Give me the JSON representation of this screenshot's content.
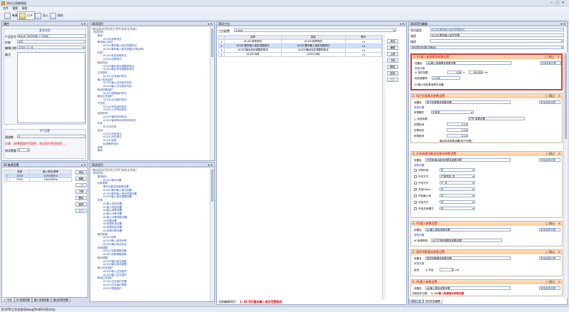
{
  "app": {
    "title": "测试方案编辑器",
    "min": "─",
    "max": "□",
    "close": "✕"
  },
  "menu": [
    "文件",
    "视图",
    "帮助"
  ],
  "toolbar": [
    "新建",
    "打开",
    "导入",
    "保存"
  ],
  "props": {
    "header": "属性",
    "product_group": "基本信息",
    "fields": [
      {
        "label": "产品型号",
        "value": "BxJu5_2005046_(-750N)"
      },
      {
        "label": "作者",
        "value": "ATE"
      },
      {
        "label": "编辑日期",
        "value": "2025 / 3 / 6"
      },
      {
        "label": "备注",
        "value": ""
      }
    ],
    "ivt_group": "IVT设置",
    "ivt_fields": [
      {
        "label": "通道数",
        "value": "0"
      },
      {
        "label": "测试数量",
        "value": "0"
      }
    ],
    "ivt_note": "注意：选择通道时先暂停，测试项目将添加到……"
  },
  "power": {
    "header": "AC电源设置",
    "cols": [
      "",
      "名称",
      "输入电压/频率"
    ],
    "rows": [
      {
        "idx": "1",
        "name": "120V",
        "val": "120V/60Hz"
      },
      {
        "idx": "2",
        "name": "230V",
        "val": "230V/50Hz"
      }
    ],
    "buttons": [
      "添加",
      "编辑",
      "上移",
      "下移",
      "删除",
      "复制",
      "粘贴"
    ]
  },
  "bottom_tabs": [
    "AC电源",
    "DC电源设置",
    "输入电源设置",
    "输出负载设置"
  ],
  "lib_tree": {
    "header": "测试项目",
    "subheader": "(拖动测试项目到工序栏或双击添加)",
    "items": [
      "测试项目",
      "静态",
      "AC/DC效率测试",
      "基本输入测试",
      "AC/DC基本输入电压范围测试",
      "AC/DC基本输入电压范围(计算功率)",
      "负载",
      "AC/DC动态负载测试",
      "AC/DC负载测试",
      "输出特性",
      "AC/DC输出电压调整率测试",
      "AC/DC输出电流调整率测试",
      "过流保护",
      "AC/DC过流保护测试",
      "输入电压保护",
      "AC/DC输入过压保护测试",
      "AC/DC输入欠压保护测试",
      "输出短路保护",
      "AC/DC短路保护测试",
      "输出过压保护",
      "AC/DC过压保护测试",
      "开关机",
      "AC/DC开机延时测试",
      "AC/DC上升时间测试",
      "保持时间",
      "AC/DC保持时间测试",
      "AC/DC保持时间(依时间测试)",
      "时序",
      "AC/DC时序",
      "启动",
      "AC/DC开机测试",
      "AC/DC关机测试",
      "AC/DC浪涌",
      "纹波噪声测试",
      "效率",
      "静态"
    ]
  },
  "cfg_tree": {
    "header": "测试项目",
    "subheader": "(拖动测试项目到工序栏或双击添加)",
    "items": [
      "测试项目",
      "基本输入",
      "AC/DC基本设置",
      "控制参数",
      "基本功能控制参数设置",
      "AC/DC基本输入电压设置",
      "AC/DC基本输入电压范围设置",
      "AC/DC输入电压调整设置",
      "其他",
      "AC输入电压设置",
      "AC输入电流设置",
      "AC输入频率设置",
      "AC输入功率设置",
      "AC输入功率因数设置",
      "AC负载设置",
      "AC负载电流设置",
      "AC负载电压设置",
      "AC负载功率设置",
      "静态参数",
      "AC/DC效率",
      "AC/DC输入电流效率",
      "AC/DC输出电压电流",
      "负载调整",
      "AC/DC负载调整设置",
      "AC/DC负载调整参数",
      "输出调整",
      "AC/DC输出电压调整",
      "AC/DC输出电流调整",
      "输入电压保护",
      "AC/DC输入过压保护",
      "AC/DC输入欠压保护",
      "输出过压保护",
      "AC/DC过压保护设置",
      "AC/DC过压保护参数",
      "AC/DC短路保护"
    ]
  },
  "seq": {
    "header": "测试工位",
    "label": "工位配置",
    "value": "1.test",
    "cols": [
      "",
      "名称",
      "描述",
      "条件"
    ],
    "rows": [
      {
        "i": "1",
        "name": "AC/DC效率测试",
        "desc": "AC/DC效率测试",
        "c": "<1"
      },
      {
        "i": "2",
        "name": "AC/DC基本输入电压范围测试",
        "desc": "AC/DC基本输入电压范围测试",
        "c": "<1"
      },
      {
        "i": "3",
        "name": "AC/DC输出电压调整率测试",
        "desc": "AC/DC输出电压调整率测试",
        "c": "<1"
      },
      {
        "i": "4",
        "name": "AC/DC功耗",
        "desc": "AC/DC功耗",
        "c": "<1"
      }
    ],
    "buttons": [
      "添加",
      "编辑",
      "上移",
      "下移",
      "删除",
      "复制",
      "粘贴"
    ],
    "status_label": "当前编辑项目:",
    "status_value": "1. AC/DC基本输入电压范围测试"
  },
  "detail": {
    "header": "测试项目编辑",
    "rows": [
      {
        "label": "项目类型",
        "value": "AC/DC基本输入电压范围测试"
      },
      {
        "label": "描述",
        "value": "AC/DC基本输入电压范围"
      },
      {
        "label": "描述",
        "value": ""
      }
    ],
    "filter": "测试项目列表(可拖动)",
    "cards": [
      {
        "title": "1. AC输入电源基本参数设置",
        "check": "□ 跳过",
        "f1": "设置名",
        "v1": "AC输入电源基本参数设置",
        "btn": "常用参数设置",
        "sec": "参数设置",
        "lines": [
          "☑ 电压范围",
          "电压调整率",
          "AC输入电压基准条件设置"
        ],
        "lo": "100",
        "lo_u": "V",
        "hi": "90.000",
        "hi_u": "Hz",
        "pf": "1.000"
      },
      {
        "title": "2. 电子负载基本参数设置",
        "check": "□ 跳过",
        "f1": "设置名",
        "v1": "电子负载基本参数设置",
        "btn": "常用参数设置",
        "sec": "参数设置",
        "mode_l": "负载模式",
        "mode_v": "定电流",
        "a_l": "□ 动态负载",
        "b_l": "打开  参数设置",
        "r1": "拉载电流",
        "r1v": "0.10",
        "r2": "拉载电压",
        "r2v": "0.10",
        "r3": "负载电流",
        "r3v": "0.10",
        "note": "最后电流参数设置(电子负载)"
      },
      {
        "title": "3. 开关电源功能测试基本参数设置",
        "check": "□ 跳过",
        "f1": "设置名",
        "v1": "开关电源功能测试基本参数设置",
        "btn": "常用参数设置",
        "sec": "参数设置",
        "opts": [
          {
            "l": "开机时间",
            "v": "无"
          },
          {
            "l": "开关方式",
            "v": "正常开机_关"
          },
          {
            "l": "开关方式",
            "v": "正_关"
          },
          {
            "l": "开启Delay",
            "v": "无"
          },
          {
            "l": "开启输入电",
            "v": "无"
          },
          {
            "l": "开启方式",
            "v": "无"
          },
          {
            "l": "开启关闭模式",
            "v": "无"
          }
        ]
      },
      {
        "title": "4. AC输入参数设置",
        "check": "□ 跳过",
        "f1": "设置名",
        "v1": "AC输入基本参数设置",
        "btn": "常用参数设置",
        "sec": "参数设置",
        "note_l": "AC电源类型",
        "note_v": "AC/交流电源基本参数设置"
      },
      {
        "title": "5. 保护判断基本参数设置",
        "check": "□ 跳过",
        "f1": "设置名",
        "v1": "保护判断基本参数设置",
        "btn": "常用参数设置",
        "sec": "参数设置",
        "x_l": "延迟",
        "x_c": "☑ 开启",
        "x_v": "0",
        "x_u": "ms"
      },
      {
        "title": "6. AC输入参数设置",
        "check": "□ 跳过",
        "f1": "设置名",
        "v1": "AC输入基本参数设置",
        "btn": "常用参数设置",
        "sel_l": "当前选中元素:",
        "sel_v": "2. AC输入电源基本参数设置"
      }
    ],
    "tabs": [
      "测试工位",
      "测试项目编辑"
    ]
  },
  "statusbar": "D:\\ATE\\工作目录\\Debug\\TestFile\\Test.tp"
}
